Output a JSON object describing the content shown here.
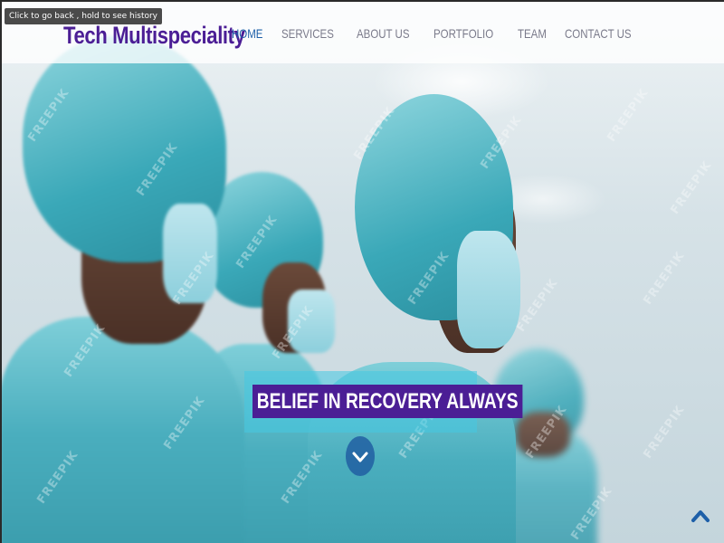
{
  "browser": {
    "tooltip": "Click to go back , hold to see history"
  },
  "header": {
    "brand": "Tech Multispeciality",
    "nav": [
      {
        "label": "HOME",
        "active": true
      },
      {
        "label": "SERVICES",
        "active": false
      },
      {
        "label": "ABOUT US",
        "active": false
      },
      {
        "label": "PORTFOLIO",
        "active": false
      },
      {
        "label": "TEAM",
        "active": false
      },
      {
        "label": "CONTACT US",
        "active": false
      }
    ]
  },
  "hero": {
    "tagline": "BELIEF IN RECOVERY ALWAYS",
    "watermark": "FREEPIK",
    "scroll_icon": "chevron-down-icon",
    "back_to_top_icon": "chevron-up-icon"
  },
  "colors": {
    "brand": "#4b1e95",
    "nav_active": "#1d5fa8",
    "nav_inactive": "#7a7a8a",
    "tagline_bg": "#4b1e95",
    "tagline_frame": "#46c8e1",
    "back_to_top": "#1d5fa8"
  }
}
